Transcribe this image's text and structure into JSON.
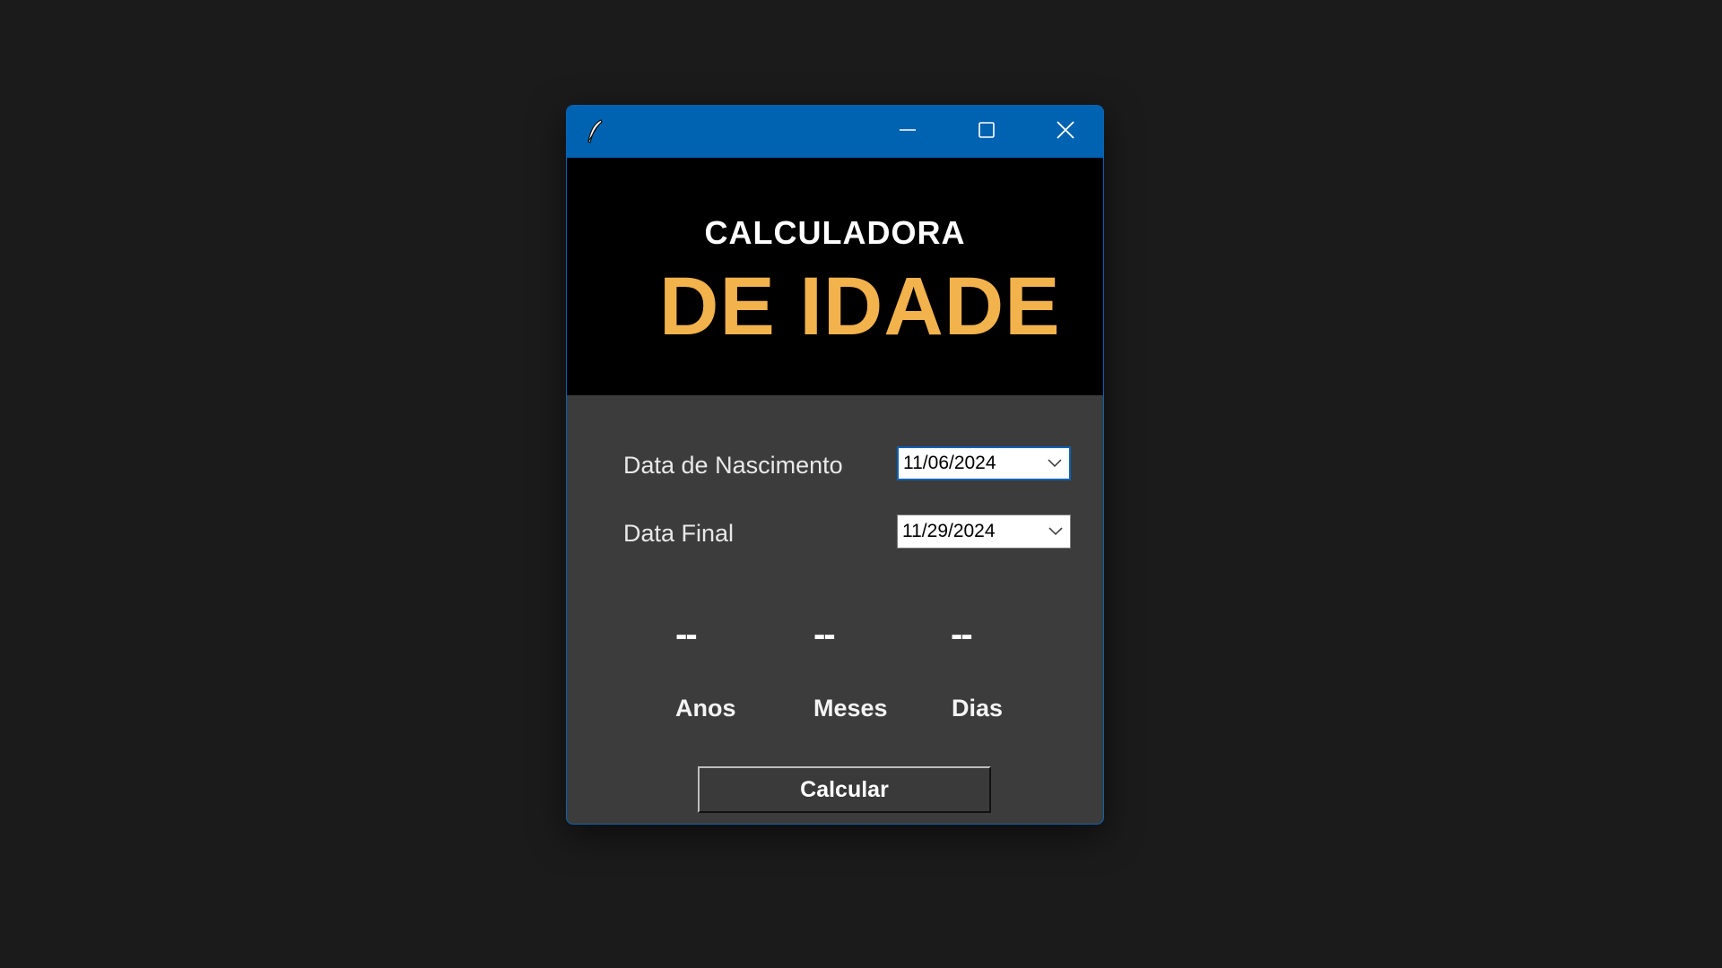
{
  "window": {
    "icon": "feather-icon",
    "controls": {
      "minimize": "minimize-icon",
      "maximize": "maximize-icon",
      "close": "close-icon"
    }
  },
  "header": {
    "title_line1": "CALCULADORA",
    "title_line2": "DE IDADE",
    "accent_color": "#f2b24c"
  },
  "form": {
    "birth_label": "Data de Nascimento",
    "birth_value": "11/06/2024",
    "final_label": "Data Final",
    "final_value": "11/29/2024"
  },
  "results": {
    "years_value": "--",
    "years_label": "Anos",
    "months_value": "--",
    "months_label": "Meses",
    "days_value": "--",
    "days_label": "Dias"
  },
  "actions": {
    "calculate_label": "Calcular"
  },
  "colors": {
    "titlebar": "#0063b1",
    "header_bg": "#000000",
    "body_bg": "#3c3c3c"
  }
}
